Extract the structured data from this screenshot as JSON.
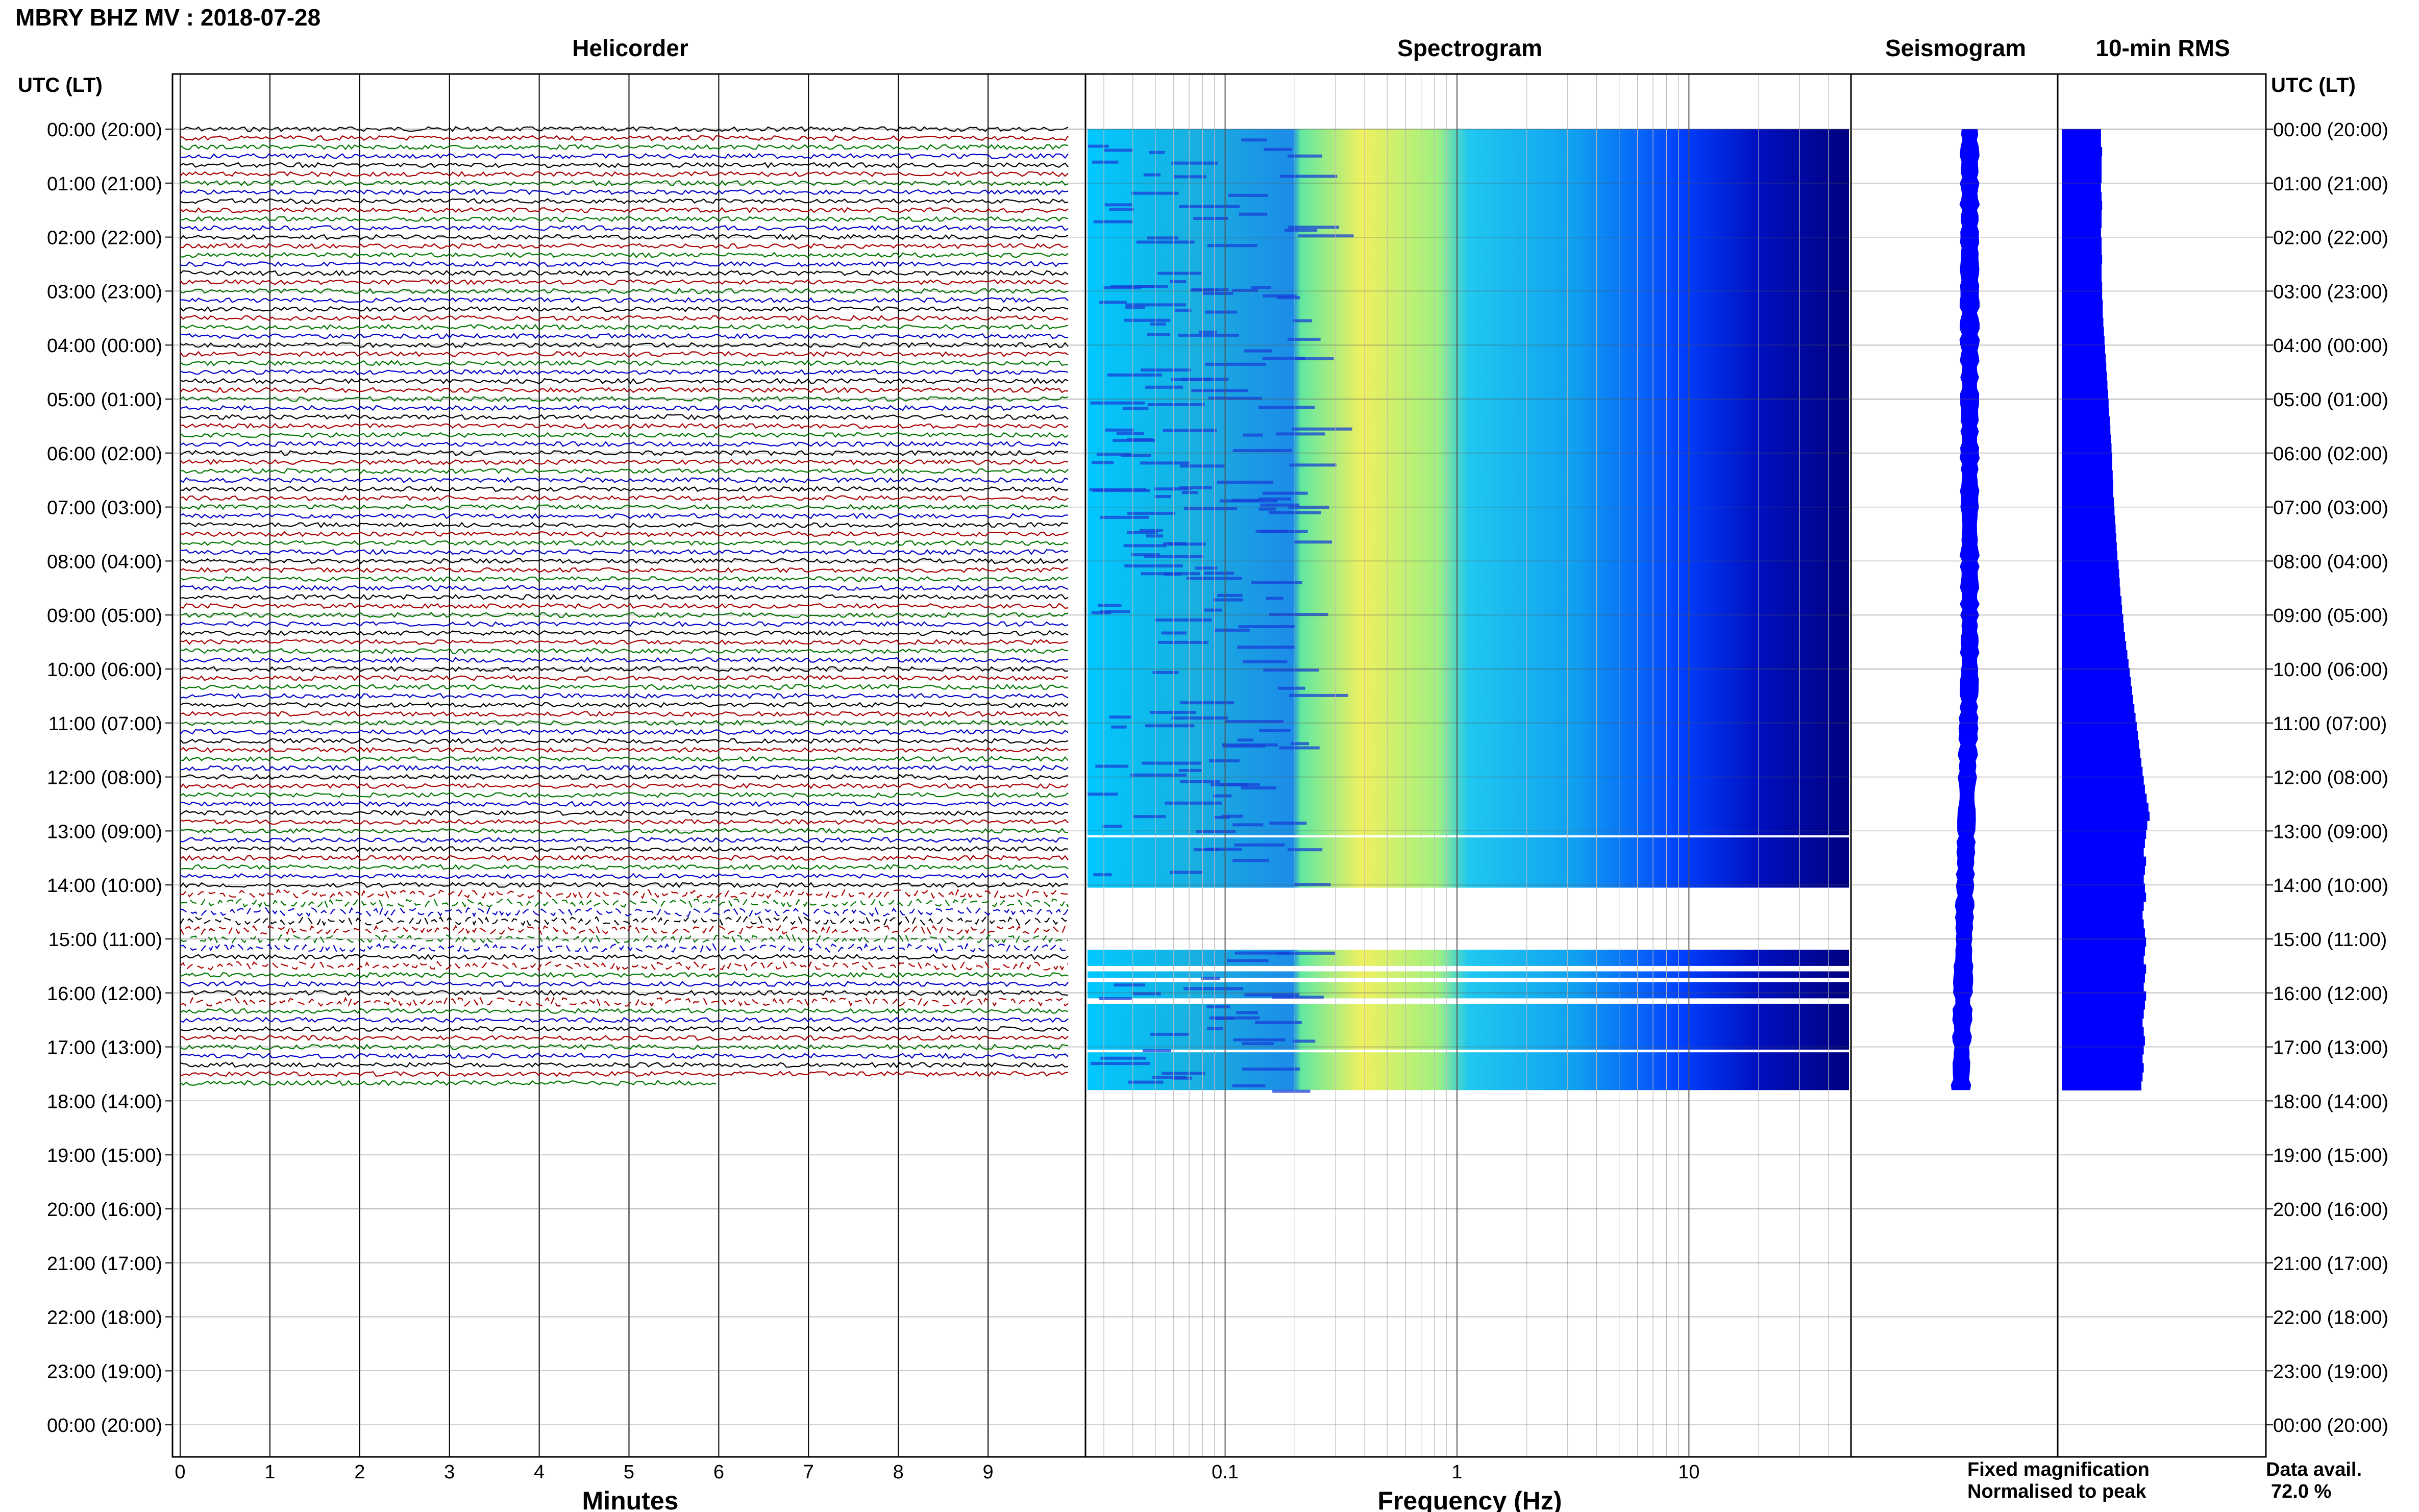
{
  "header": {
    "title": "MBRY BHZ MV : 2018-07-28"
  },
  "panels": {
    "helicorder": "Helicorder",
    "spectrogram": "Spectrogram",
    "seismogram": "Seismogram",
    "rms": "10-min RMS"
  },
  "axes": {
    "time_axis_label": "UTC (LT)",
    "x_helicorder_label": "Minutes",
    "x_spectrogram_label": "Frequency (Hz)"
  },
  "legend": {
    "fixed": "Fixed magnification",
    "normalised": "Normalised to peak",
    "fixed_color": "#0000ff",
    "normalised_color": "#ff0000"
  },
  "availability": {
    "label": "Data avail.",
    "value": "72.0 %"
  },
  "colors": {
    "trace_cycle": [
      "#000000",
      "#aa0000",
      "#007700",
      "#0000cc"
    ],
    "seismogram": "#0000ff",
    "rms": "#0000ff",
    "spectrogram_scale": [
      "#00007f",
      "#0000ff",
      "#0080ff",
      "#00ffff",
      "#80ff80",
      "#ffff00"
    ]
  },
  "chart_data": {
    "type": "heatmap",
    "time_ticks": [
      "00:00 (20:00)",
      "01:00 (21:00)",
      "02:00 (22:00)",
      "03:00 (23:00)",
      "04:00 (00:00)",
      "05:00 (01:00)",
      "06:00 (02:00)",
      "07:00 (03:00)",
      "08:00 (04:00)",
      "09:00 (05:00)",
      "10:00 (06:00)",
      "11:00 (07:00)",
      "12:00 (08:00)",
      "13:00 (09:00)",
      "14:00 (10:00)",
      "15:00 (11:00)",
      "16:00 (12:00)",
      "17:00 (13:00)",
      "18:00 (14:00)",
      "19:00 (15:00)",
      "20:00 (16:00)",
      "21:00 (17:00)",
      "22:00 (18:00)",
      "23:00 (19:00)",
      "00:00 (20:00)"
    ],
    "minute_ticks": [
      "0",
      "1",
      "2",
      "3",
      "4",
      "5",
      "6",
      "7",
      "8",
      "9"
    ],
    "minute_values": [
      0,
      1,
      2,
      3,
      4,
      5,
      6,
      7,
      8,
      9
    ],
    "minutes_range": [
      0,
      10
    ],
    "frequency_ticks": [
      "0.1",
      "1",
      "10"
    ],
    "frequency_values": [
      0.1,
      1,
      10
    ],
    "frequency_range": [
      0.025,
      50
    ],
    "frequency_log": true,
    "data_end_hour": 17.8,
    "gaps_hours": [
      [
        13.08,
        13.12
      ],
      [
        14.05,
        15.2
      ],
      [
        15.5,
        15.6
      ],
      [
        15.72,
        15.8
      ],
      [
        16.1,
        16.2
      ],
      [
        17.05,
        17.1
      ]
    ],
    "rms_values": [
      0.67,
      0.67,
      0.69,
      0.68,
      0.68,
      0.68,
      0.67,
      0.68,
      0.69,
      0.68,
      0.68,
      0.67,
      0.68,
      0.68,
      0.69,
      0.68,
      0.68,
      0.69,
      0.69,
      0.7,
      0.7,
      0.71,
      0.72,
      0.73,
      0.74,
      0.75,
      0.76,
      0.77,
      0.78,
      0.79,
      0.8,
      0.81,
      0.82,
      0.83,
      0.84,
      0.85,
      0.86,
      0.86,
      0.87,
      0.88,
      0.88,
      0.89,
      0.9,
      0.91,
      0.92,
      0.93,
      0.94,
      0.95,
      0.97,
      0.98,
      0.99,
      1.0,
      1.02,
      1.03,
      1.05,
      1.06,
      1.08,
      1.1,
      1.12,
      1.14,
      1.16,
      1.18,
      1.2,
      1.22,
      1.24,
      1.26,
      1.28,
      1.3,
      1.32,
      1.34,
      1.36,
      1.38,
      1.4,
      1.42,
      1.45,
      1.48,
      1.5,
      1.46,
      1.44,
      1.42,
      1.4,
      1.44,
      1.42,
      1.4,
      1.42,
      1.44,
      1.4,
      1.38,
      1.4,
      1.42,
      1.44,
      1.42,
      1.4,
      1.44,
      1.42,
      1.4,
      1.44,
      1.42,
      1.4,
      1.38,
      1.4,
      1.42,
      1.4,
      1.38,
      1.4,
      1.38,
      1.36
    ]
  }
}
